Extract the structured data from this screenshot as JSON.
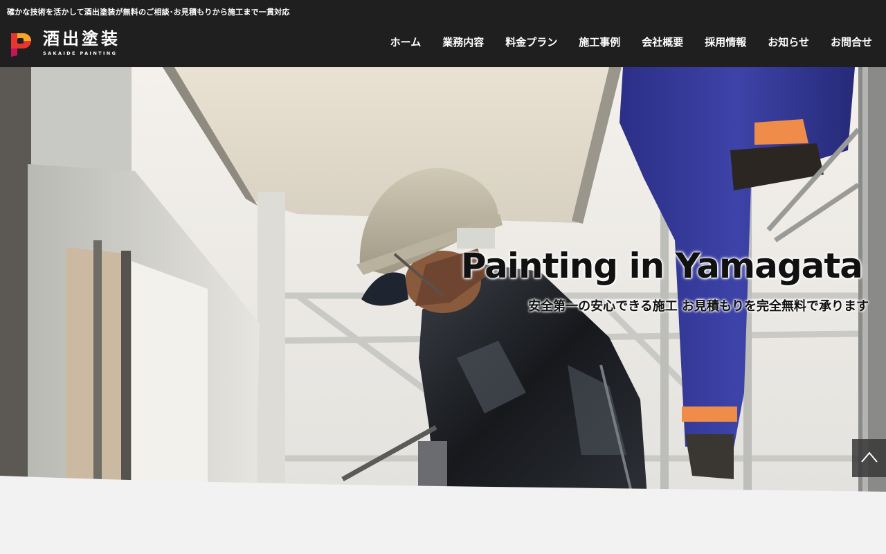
{
  "header": {
    "tagline": "確かな技術を活かして酒出塗装が無料のご相談･お見積もりから施工まで一貫対応",
    "logo": {
      "mark_letter": "P",
      "name": "酒出塗装",
      "romaji": "SAKAIDE PAINTING",
      "mark_colors": [
        "#f5a623",
        "#e8352f",
        "#c2185b"
      ]
    },
    "nav": [
      "ホーム",
      "業務内容",
      "料金プラン",
      "施工事例",
      "会社概要",
      "採用情報",
      "お知らせ",
      "お問合せ"
    ]
  },
  "hero": {
    "title": "Painting in Yamagata",
    "subtitle": "安全第一の安心できる施工 お見積もりを完全無料で承ります",
    "image": "painter-on-scaffolding-photo"
  },
  "scroll_top": {
    "icon": "chevron-up-icon"
  }
}
